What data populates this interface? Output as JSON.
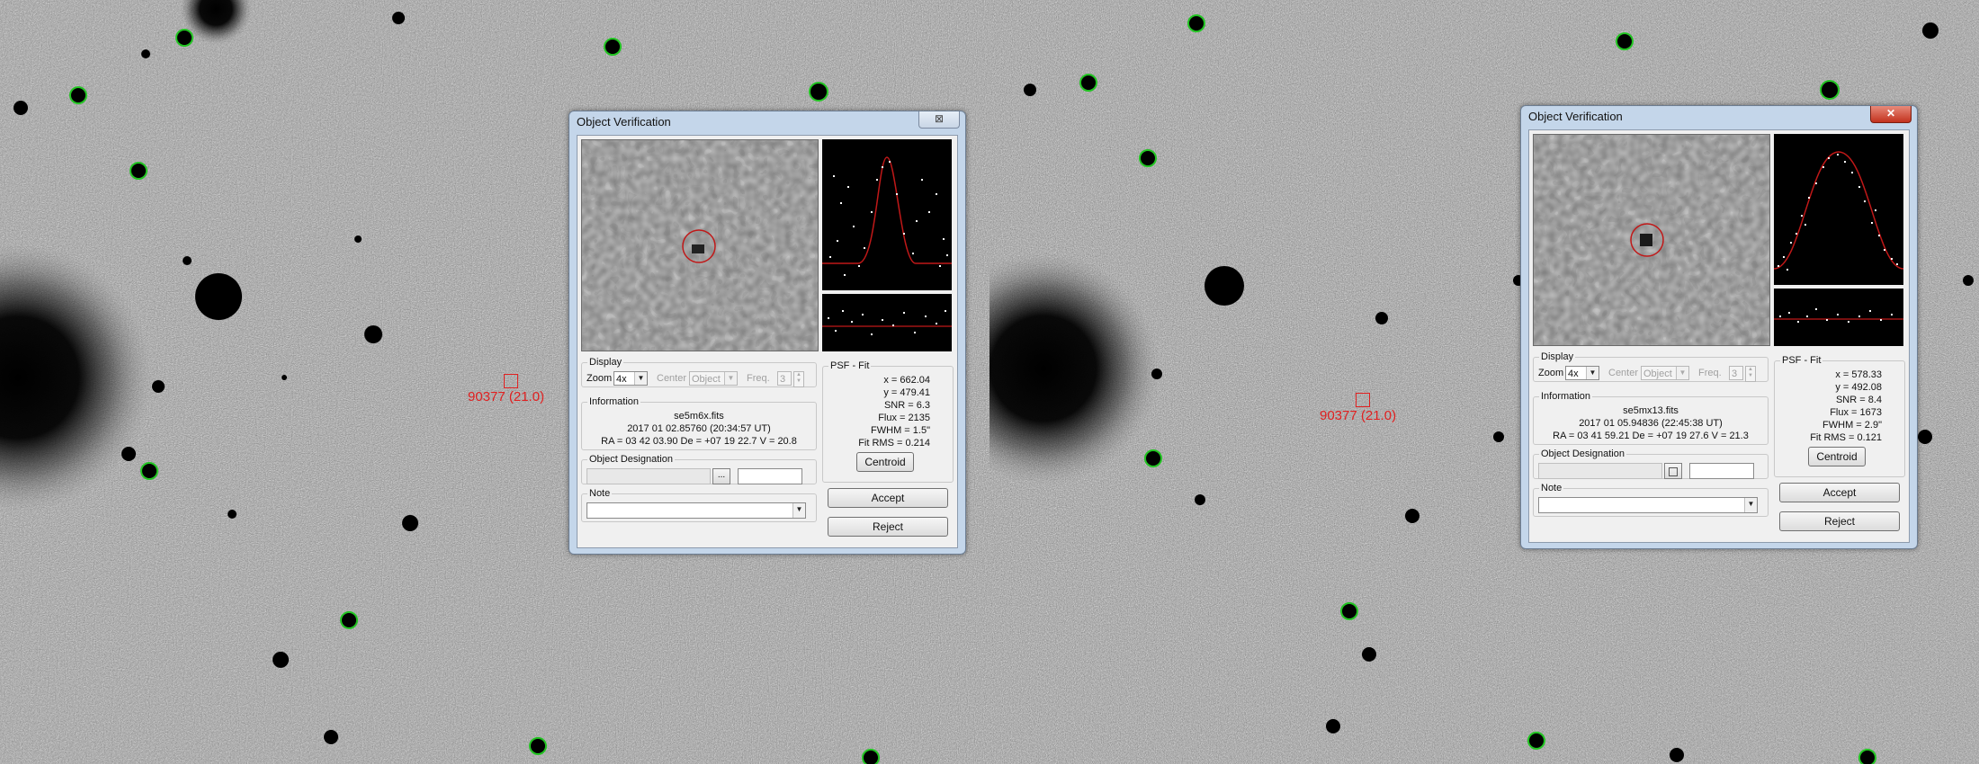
{
  "left_window": {
    "title": "Object Verification",
    "close_label": "⊠",
    "asteroid_label": "90377 (21.0)",
    "display": {
      "legend": "Display",
      "zoom_label": "Zoom",
      "zoom_value": "4x",
      "center_label": "Center",
      "center_value": "Object",
      "freq_label": "Freq.",
      "freq_value": "3"
    },
    "information": {
      "legend": "Information",
      "file": "se5m6x.fits",
      "date": "2017 01 02.85760 (20:34:57 UT)",
      "coords": "RA = 03 42 03.90   De = +07 19 22.7   V = 20.8"
    },
    "designation": {
      "legend": "Object Designation",
      "browse_label": "..."
    },
    "note": {
      "legend": "Note"
    },
    "psf": {
      "legend": "PSF - Fit",
      "x": "x = 662.04",
      "y": "y = 479.41",
      "snr": "SNR = 6.3",
      "flux": "Flux = 2135",
      "fwhm": "FWHM = 1.5\"",
      "rms": "Fit RMS = 0.214",
      "centroid_label": "Centroid"
    },
    "accept_label": "Accept",
    "reject_label": "Reject"
  },
  "right_window": {
    "title": "Object Verification",
    "close_label": "✕",
    "asteroid_label": "90377 (21.0)",
    "display": {
      "legend": "Display",
      "zoom_label": "Zoom",
      "zoom_value": "4x",
      "center_label": "Center",
      "center_value": "Object",
      "freq_label": "Freq.",
      "freq_value": "3"
    },
    "information": {
      "legend": "Information",
      "file": "se5mx13.fits",
      "date": "2017 01 05.94836 (22:45:38 UT)",
      "coords": "RA = 03 41 59.21   De = +07 19 27.6   V = 21.3"
    },
    "designation": {
      "legend": "Object Designation",
      "browse_label": ""
    },
    "note": {
      "legend": "Note"
    },
    "psf": {
      "legend": "PSF - Fit",
      "x": "x = 578.33",
      "y": "y = 492.08",
      "snr": "SNR = 8.4",
      "flux": "Flux = 1673",
      "fwhm": "FWHM = 2.9\"",
      "rms": "Fit RMS = 0.121",
      "centroid_label": "Centroid"
    },
    "accept_label": "Accept",
    "reject_label": "Reject"
  },
  "colors": {
    "marker_green": "#22c422",
    "asteroid_red": "#e02020",
    "psf_curve": "#c01818"
  }
}
